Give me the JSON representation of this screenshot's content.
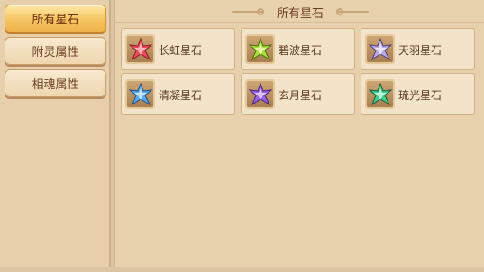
{
  "sidebar": {
    "items": [
      {
        "label": "所有星石",
        "active": true
      },
      {
        "label": "附灵属性",
        "active": false
      },
      {
        "label": "相魂属性",
        "active": false
      }
    ]
  },
  "panel": {
    "title": "所有星石",
    "stones": [
      {
        "label": "长虹星石",
        "icon": "red-star-stone-icon",
        "color": "#f04a5a"
      },
      {
        "label": "碧波星石",
        "icon": "green-star-stone-icon",
        "color": "#a6e03a"
      },
      {
        "label": "天羽星石",
        "icon": "lavender-star-stone-icon",
        "color": "#b9a9ea"
      },
      {
        "label": "清凝星石",
        "icon": "blue-star-stone-icon",
        "color": "#58a9f2"
      },
      {
        "label": "玄月星石",
        "icon": "purple-star-stone-icon",
        "color": "#9a62e6"
      },
      {
        "label": "琉光星石",
        "icon": "teal-star-stone-icon",
        "color": "#3fcf8b"
      }
    ]
  },
  "colors": {
    "active_tab": "#f5c461",
    "background": "#e8d2ae",
    "text": "#6b3f1e"
  }
}
